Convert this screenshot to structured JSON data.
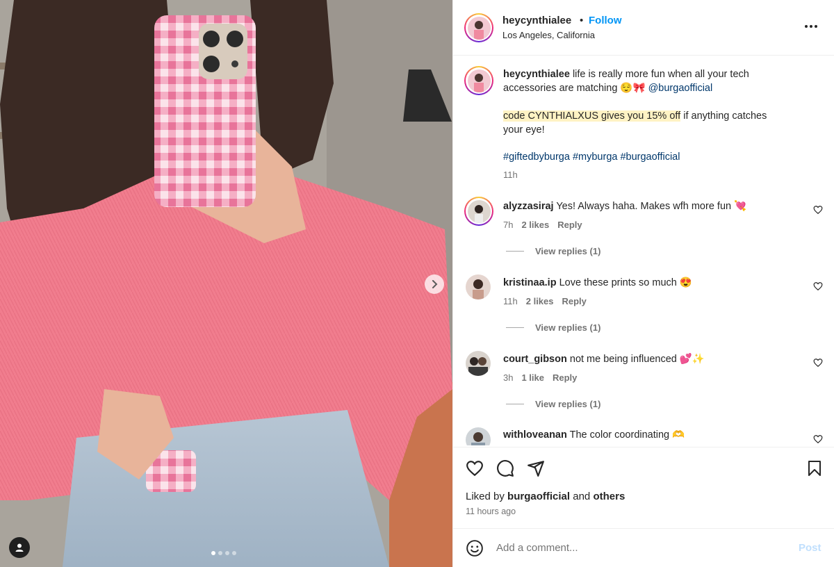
{
  "post": {
    "username": "heycynthialee",
    "separator": "•",
    "follow_label": "Follow",
    "location": "Los Angeles, California"
  },
  "caption": {
    "username": "heycynthialee",
    "line1": "life is really more fun when all your tech",
    "line2_text": "accessories are matching 😌🎀",
    "line2_mention": "@burgaofficial",
    "code_highlight": "code CYNTHIALXUS gives you 15% off",
    "code_rest": "if anything catches",
    "code_line2": "your eye!",
    "hashtags": "#giftedbyburga #myburga #burgaofficial",
    "time": "11h"
  },
  "comments": [
    {
      "user": "alyzzasiraj",
      "text": "Yes! Always haha. Makes wfh more fun 💘",
      "time": "7h",
      "likes": "2 likes",
      "reply": "Reply",
      "view_replies": "View replies (1)"
    },
    {
      "user": "kristinaa.ip",
      "text": "Love these prints so much 😍",
      "time": "11h",
      "likes": "2 likes",
      "reply": "Reply",
      "view_replies": "View replies (1)"
    },
    {
      "user": "court_gibson",
      "text": "not me being influenced 💕✨",
      "time": "3h",
      "likes": "1 like",
      "reply": "Reply",
      "view_replies": "View replies (1)"
    },
    {
      "user": "withloveanan",
      "text": "The color coordinating 🫶"
    }
  ],
  "likes": {
    "prefix": "Liked by",
    "user": "burgaofficial",
    "and": "and",
    "others": "others",
    "time_ago": "11 hours ago"
  },
  "composer": {
    "placeholder": "Add a comment...",
    "post_label": "Post"
  },
  "icons": {
    "like": "heart-icon",
    "comment": "comment-icon",
    "share": "paper-plane-icon",
    "save": "bookmark-icon",
    "emoji": "smiley-icon",
    "more": "more-icon",
    "next": "chevron-right-icon",
    "tag": "user-tag-icon"
  },
  "colors": {
    "follow_blue": "#0095f6",
    "mention": "#00376b",
    "highlight": "#fff3c4",
    "sweater_pink": "#f07f8f",
    "gingham_pink": "#ee8aa6"
  },
  "carousel": {
    "total": 4,
    "active": 1
  }
}
